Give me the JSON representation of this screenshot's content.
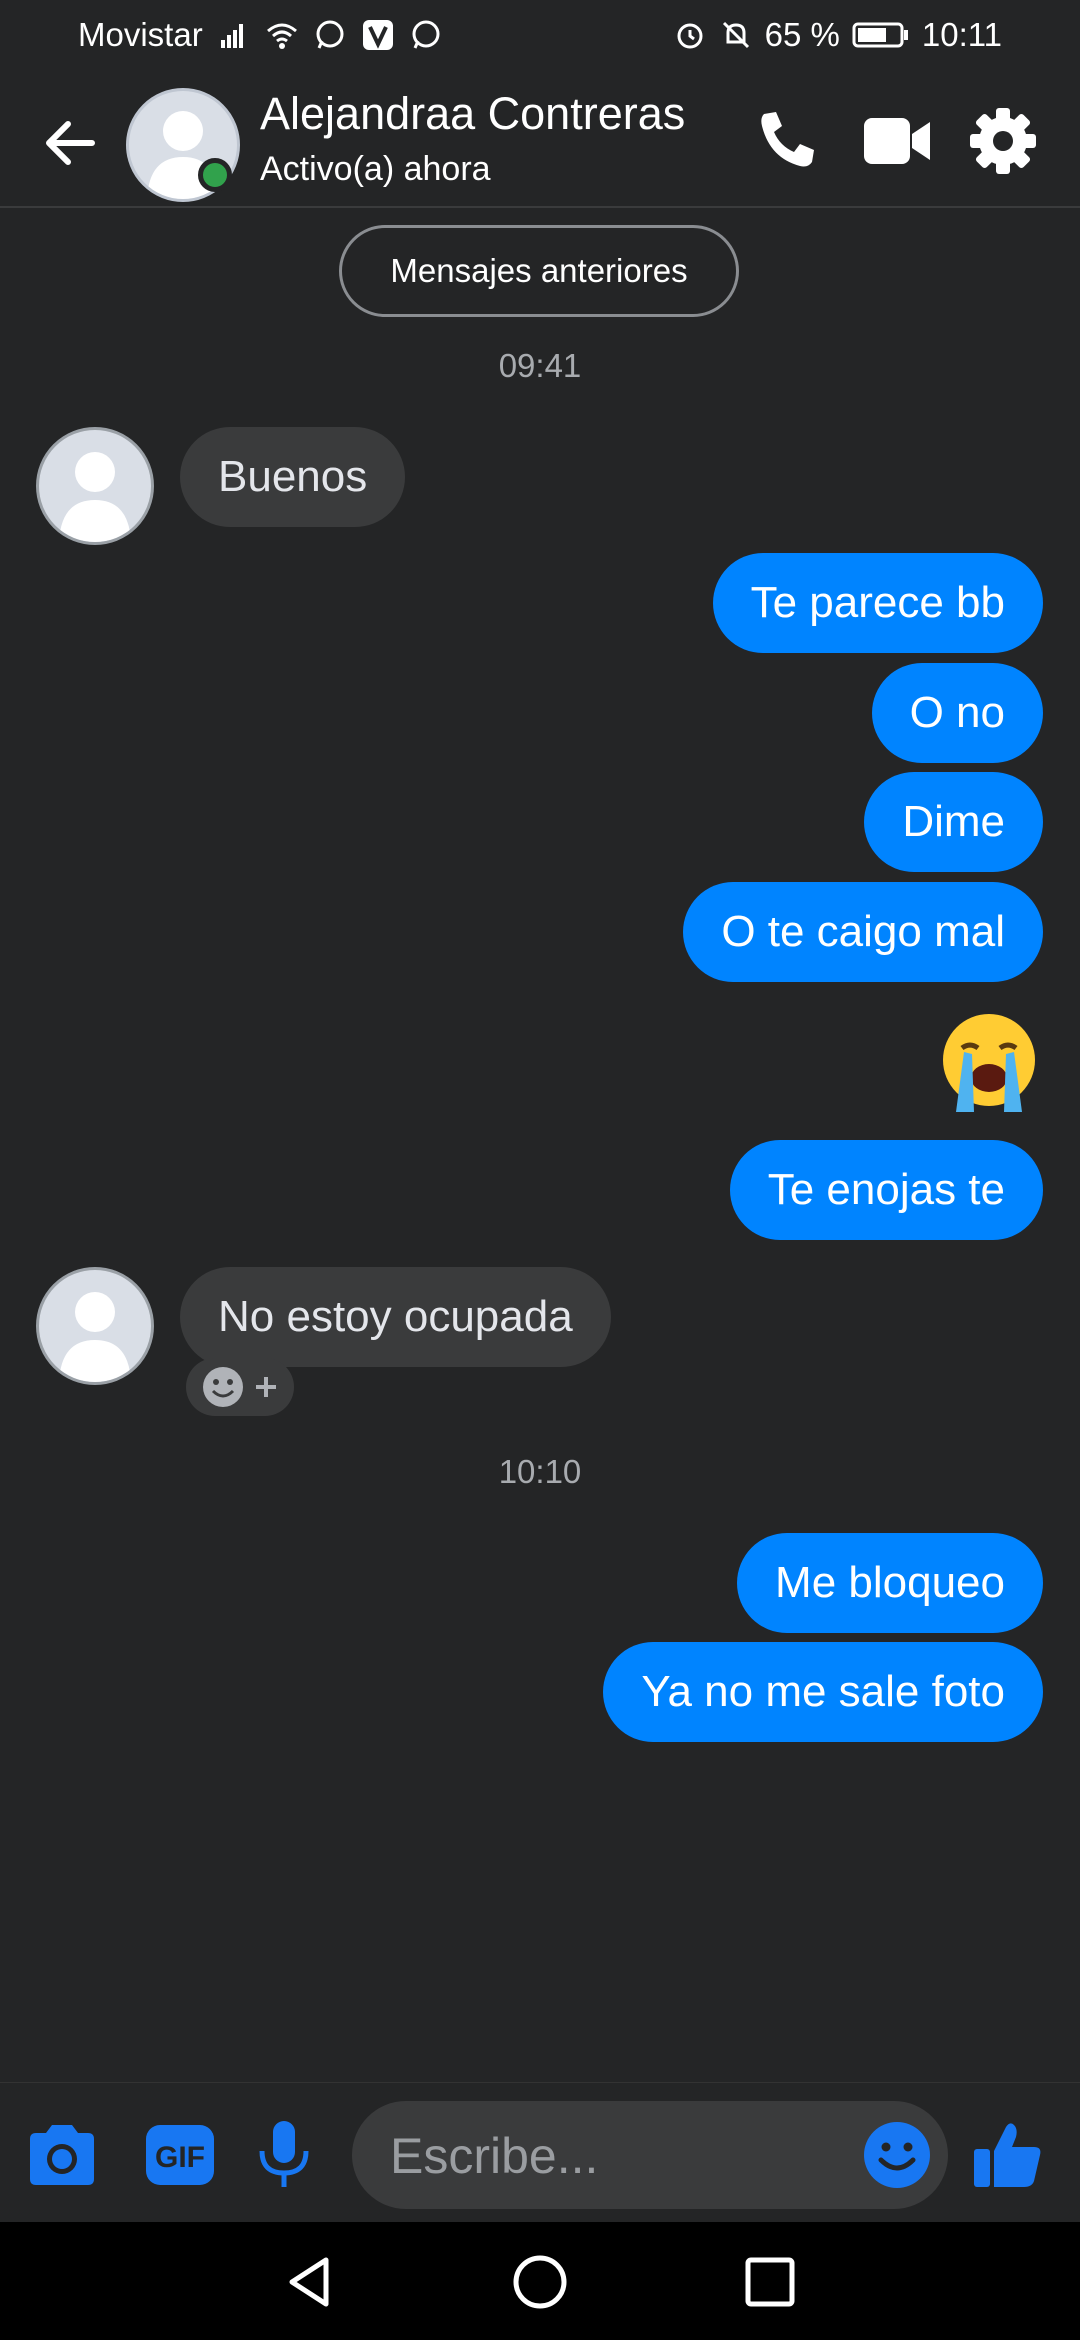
{
  "status_bar": {
    "carrier": "Movistar",
    "battery": "65 %",
    "time": "10:11",
    "icons": [
      "signal-icon",
      "wifi-icon",
      "whatsapp-icon",
      "v-app-icon",
      "whatsapp-icon",
      "alarm-icon",
      "bell-off-icon",
      "battery-icon"
    ]
  },
  "header": {
    "contact_name": "Alejandraa Contreras",
    "status": "Activo(a) ahora",
    "icons": [
      "back-arrow-icon",
      "phone-icon",
      "video-icon",
      "gear-icon"
    ]
  },
  "chat": {
    "older_messages_label": "Mensajes anteriores",
    "timestamps": [
      "09:41",
      "10:10"
    ],
    "messages": [
      {
        "side": "in",
        "text": "Buenos"
      },
      {
        "side": "out",
        "text": "Te parece bb"
      },
      {
        "side": "out",
        "text": "O no"
      },
      {
        "side": "out",
        "text": "Dime"
      },
      {
        "side": "out",
        "text": "O te caigo mal"
      },
      {
        "side": "out",
        "emoji": "loudly-crying-face"
      },
      {
        "side": "out",
        "text": "Te enojas te"
      },
      {
        "side": "in",
        "text": "No estoy ocupada"
      },
      {
        "side": "out",
        "text": "Me bloqueo"
      },
      {
        "side": "out",
        "text": "Ya no me sale foto"
      }
    ]
  },
  "composer": {
    "placeholder": "Escribe...",
    "gif_label": "GIF",
    "icons": [
      "camera-icon",
      "gif-icon",
      "microphone-icon",
      "emoji-icon",
      "like-icon"
    ],
    "accent": "#1877f2"
  },
  "colors": {
    "background": "#242526",
    "outgoing_bubble": "#0084ff",
    "incoming_bubble": "#3a3b3c",
    "online": "#31a24c"
  }
}
